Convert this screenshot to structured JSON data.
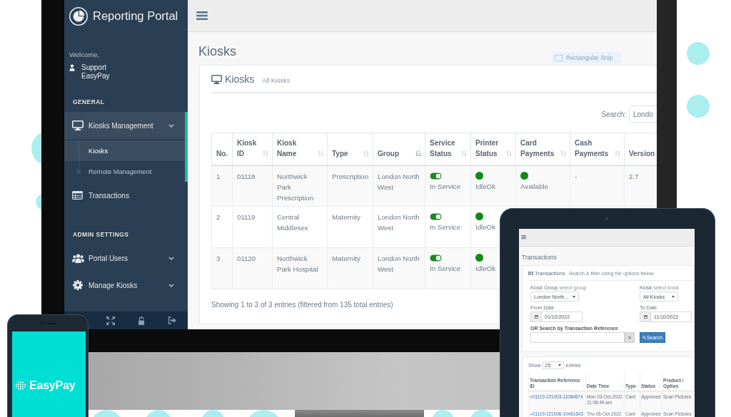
{
  "monitor": {
    "sidebar": {
      "brand": "Reporting Portal",
      "welcome": "Welcome,",
      "user": "Support EasyPay",
      "sections": [
        {
          "heading": "GENERAL",
          "items": [
            {
              "label": "Kiosks Management",
              "kind": "submenu",
              "selected": true,
              "children": [
                {
                  "label": "Kiosks",
                  "selected": true
                },
                {
                  "label": "Remote Management",
                  "selected": false
                }
              ]
            },
            {
              "label": "Transactions",
              "kind": "link",
              "selected": false
            }
          ]
        },
        {
          "heading": "ADMIN SETTINGS",
          "items": [
            {
              "label": "Portal Users",
              "kind": "submenu",
              "selected": false
            },
            {
              "label": "Manage Kiosks",
              "kind": "submenu",
              "selected": false
            }
          ]
        }
      ]
    },
    "main": {
      "page_title": "Kiosks",
      "snip_tooltip": "Rectangular Snip",
      "panel": {
        "title": "Kiosks",
        "subtitle": "All Kiosks",
        "search": {
          "label": "Search:",
          "value": "Londo"
        },
        "table": {
          "columns": [
            {
              "label": "No.",
              "sortable": false
            },
            {
              "label": "Kiosk ID",
              "sortable": true,
              "sorted": false
            },
            {
              "label": "Kiosk Name",
              "sortable": true,
              "sorted": false
            },
            {
              "label": "Type",
              "sortable": true,
              "sorted": false
            },
            {
              "label": "Group",
              "sortable": true,
              "sorted": true
            },
            {
              "label": "Service Status",
              "sortable": true,
              "sorted": false
            },
            {
              "label": "Printer Status",
              "sortable": true,
              "sorted": false
            },
            {
              "label": "Card Payments",
              "sortable": true,
              "sorted": false
            },
            {
              "label": "Cash Payments",
              "sortable": true,
              "sorted": false
            },
            {
              "label": "Version",
              "sortable": false
            }
          ],
          "rows": [
            {
              "cells": [
                {
                  "kind": "text",
                  "text": "1"
                },
                {
                  "kind": "text",
                  "text": "01118"
                },
                {
                  "kind": "text",
                  "text": "Northwick Park Prescription"
                },
                {
                  "kind": "text",
                  "text": "Prescription"
                },
                {
                  "kind": "text",
                  "text": "London North West"
                },
                {
                  "kind": "toggle",
                  "on": true,
                  "text": "In Service"
                },
                {
                  "kind": "dot",
                  "color": "#0e8a16",
                  "text": "IdleOk"
                },
                {
                  "kind": "dot",
                  "color": "#0e8a16",
                  "text": "Available"
                },
                {
                  "kind": "text",
                  "text": "-"
                },
                {
                  "kind": "text",
                  "text": "2.7"
                }
              ]
            },
            {
              "cells": [
                {
                  "kind": "text",
                  "text": "2"
                },
                {
                  "kind": "text",
                  "text": "01119"
                },
                {
                  "kind": "text",
                  "text": "Central Middlesex"
                },
                {
                  "kind": "text",
                  "text": "Maternity"
                },
                {
                  "kind": "text",
                  "text": "London North West"
                },
                {
                  "kind": "toggle",
                  "on": true,
                  "text": "In Service"
                },
                {
                  "kind": "dot",
                  "color": "#0e8a16",
                  "text": "IdleOk"
                }
              ]
            },
            {
              "cells": [
                {
                  "kind": "text",
                  "text": "3"
                },
                {
                  "kind": "text",
                  "text": "01120"
                },
                {
                  "kind": "text",
                  "text": "Northwick Park Hospital"
                },
                {
                  "kind": "text",
                  "text": "Maternity"
                },
                {
                  "kind": "text",
                  "text": "London North West"
                },
                {
                  "kind": "toggle",
                  "on": true,
                  "text": "In Service"
                },
                {
                  "kind": "dot",
                  "color": "#0e8a16",
                  "text": "IdleOk"
                }
              ]
            }
          ]
        },
        "info": "Showing 1 to 3 of 3 entries (filtered from 135 total entries)"
      }
    }
  },
  "tablet": {
    "page_title": "Transactions",
    "filter_panel": {
      "title": "Transactions",
      "subtitle": "Search & filter using the options below",
      "fields": [
        {
          "kind": "select",
          "label": "Kiosk Group",
          "sublabel": "select group",
          "value": "London North..."
        },
        {
          "kind": "select",
          "label": "Kiosk",
          "sublabel": "select kiosk",
          "value": "All Kiosks"
        },
        {
          "kind": "date",
          "label": "From Date",
          "value": "01/10/2022"
        },
        {
          "kind": "date",
          "label": "To Date",
          "value": "11/10/2022"
        }
      ],
      "reference": {
        "label": "OR Search by Transaction Reference",
        "clear_button": "×",
        "search_button": "Search"
      }
    },
    "results_panel": {
      "show_label": "Show",
      "page_length": "25",
      "entries_label": "entries",
      "table": {
        "columns": [
          {
            "label": "Transaction Reference ID",
            "sortable": true,
            "sorted": false
          },
          {
            "label": "Date Time",
            "sortable": true,
            "sorted": false
          },
          {
            "label": "Type",
            "sortable": true,
            "sorted": false
          },
          {
            "label": "Status",
            "sortable": true,
            "sorted": false
          },
          {
            "label": "Product / Option",
            "sortable": true,
            "sorted": false
          }
        ],
        "rows": [
          {
            "cells": [
              {
                "kind": "link",
                "text": "01119-221003-11084874"
              },
              {
                "kind": "text",
                "text": "Mon 03-Oct-2022 11:08:49 am"
              },
              {
                "kind": "text",
                "text": "Card"
              },
              {
                "kind": "text",
                "text": "Approved"
              },
              {
                "kind": "text",
                "text": "Scan Pictures"
              }
            ]
          },
          {
            "cells": [
              {
                "kind": "link",
                "text": "01119-221006-10461643"
              },
              {
                "kind": "text",
                "text": "Thu 06-Oct-2022"
              },
              {
                "kind": "text",
                "text": "Card"
              },
              {
                "kind": "text",
                "text": "Approved"
              },
              {
                "kind": "text",
                "text": "Scan Pictures"
              }
            ]
          }
        ]
      }
    }
  },
  "phone": {
    "brand": "EasyPay"
  }
}
